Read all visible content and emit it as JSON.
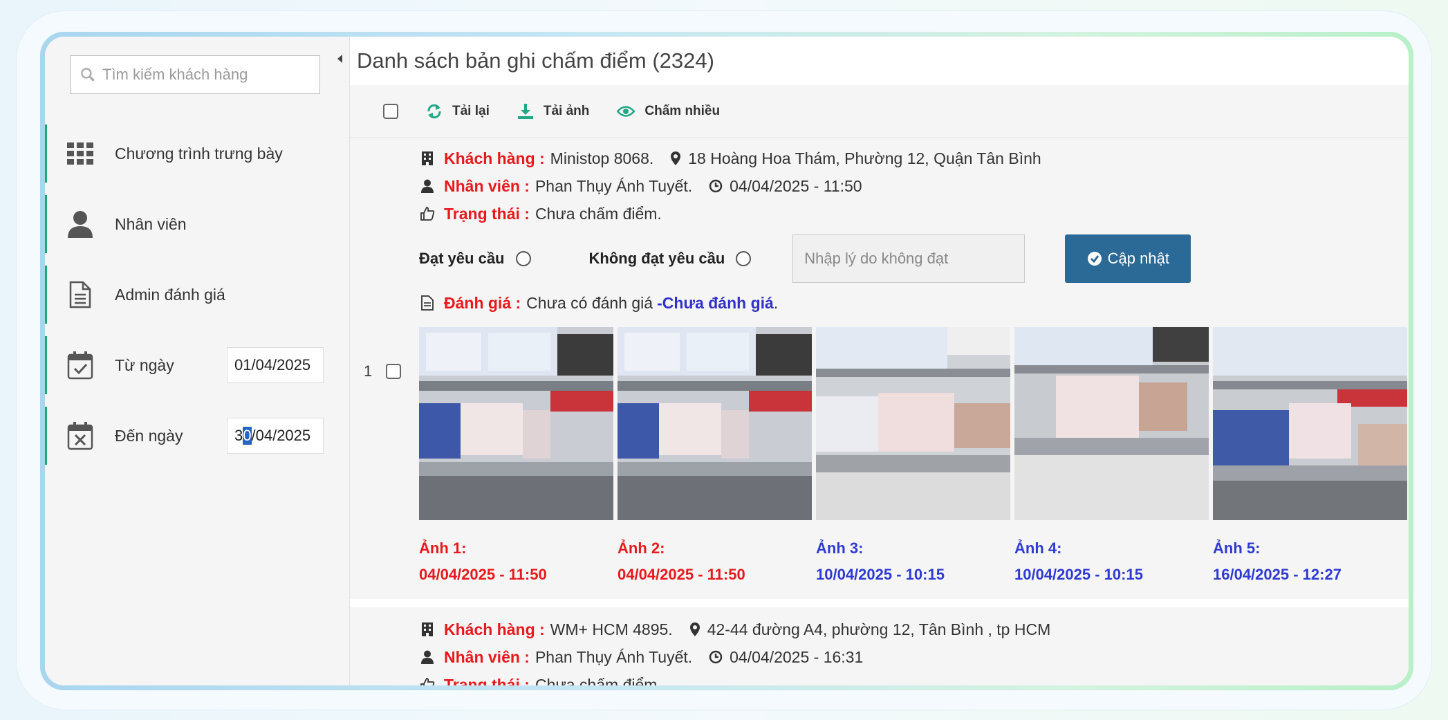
{
  "sidebar": {
    "search_placeholder": "Tìm kiếm khách hàng",
    "items": [
      {
        "label": "Chương trình trưng bày",
        "icon": "grid-icon"
      },
      {
        "label": "Nhân viên",
        "icon": "user-icon"
      },
      {
        "label": "Admin đánh giá",
        "icon": "document-icon"
      },
      {
        "label": "Từ ngày",
        "icon": "calendar-check-icon"
      },
      {
        "label": "Đến ngày",
        "icon": "calendar-x-icon"
      }
    ],
    "from_date": "01/04/2025",
    "to_date_prefix": "3",
    "to_date_selected": "0",
    "to_date_suffix": "/04/2025"
  },
  "main": {
    "title": "Danh sách bản ghi chấm điểm (2324)",
    "toolbar": {
      "reload": "Tải lại",
      "download": "Tải ảnh",
      "grade_many": "Chấm nhiều"
    }
  },
  "records": [
    {
      "index": "1",
      "customer_label": "Khách hàng :",
      "customer": "Ministop 8068.",
      "address": "18 Hoàng Hoa Thám, Phường 12, Quận Tân Bình",
      "staff_label": "Nhân viên :",
      "staff": "Phan Thụy Ánh Tuyết.",
      "time": "04/04/2025 - 11:50",
      "status_label": "Trạng thái :",
      "status": "Chưa chấm điểm.",
      "pass_label": "Đạt yêu cầu",
      "fail_label": "Không đạt yêu cầu",
      "reason_placeholder": "Nhập lý do không đạt",
      "update_label": "Cập nhật",
      "review_label": "Đánh giá :",
      "review_text": "Chưa có đánh giá",
      "review_status": "-Chưa đánh giá",
      "review_end": ".",
      "photos": [
        {
          "label": "Ảnh 1:",
          "time": "04/04/2025 - 11:50",
          "color": "#e8191c"
        },
        {
          "label": "Ảnh 2:",
          "time": "04/04/2025 - 11:50",
          "color": "#e8191c"
        },
        {
          "label": "Ảnh 3:",
          "time": "10/04/2025 - 10:15",
          "color": "#2f3ad1"
        },
        {
          "label": "Ảnh 4:",
          "time": "10/04/2025 - 10:15",
          "color": "#2f3ad1"
        },
        {
          "label": "Ảnh 5:",
          "time": "16/04/2025 - 12:27",
          "color": "#2f3ad1"
        }
      ]
    },
    {
      "customer_label": "Khách hàng :",
      "customer": "WM+ HCM 4895.",
      "address": "42-44 đường A4, phường 12, Tân Bình , tp HCM",
      "staff_label": "Nhân viên :",
      "staff": "Phan Thụy Ánh Tuyết.",
      "time": "04/04/2025 - 16:31",
      "status_label": "Trạng thái :",
      "status": "Chưa chấm điểm."
    }
  ],
  "colors": {
    "label_red": "#e8191c",
    "blue_status": "#2f3ad1",
    "button_blue": "#2b6a97",
    "accent_green": "#1fa67a"
  }
}
